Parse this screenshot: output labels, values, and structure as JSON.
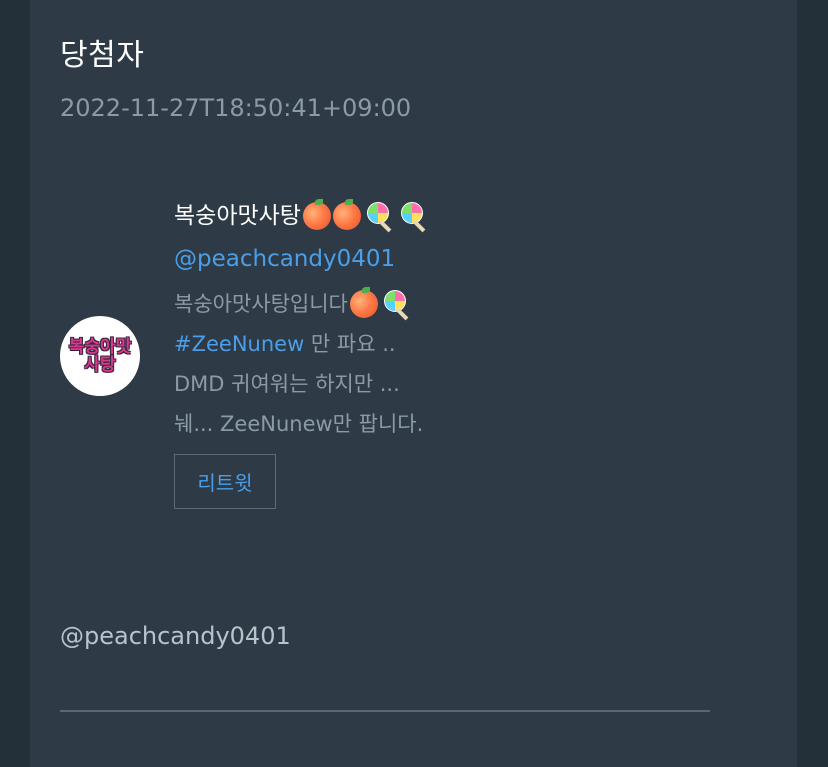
{
  "header": {
    "title": "당첨자",
    "timestamp": "2022-11-27T18:50:41+09:00"
  },
  "user": {
    "display_name": "복숭아맛사탕",
    "name_emojis": [
      "peach-icon",
      "peach-icon",
      "lollipop-icon",
      "lollipop-icon"
    ],
    "handle": "@peachcandy0401",
    "avatar_text_line1": "복숭아맛",
    "avatar_text_line2": "사탕",
    "bio": {
      "line1_text": "복숭아맛사탕입니다",
      "line1_emojis": [
        "peach-icon",
        "lollipop-icon"
      ],
      "line2_hashtag": "#ZeeNunew",
      "line2_rest": " 만 파요 ..",
      "line3": "DMD 귀여워는 하지만 ...",
      "line4": "눼... ZeeNunew만 팝니다."
    }
  },
  "actions": {
    "retweet_label": "리트윗"
  },
  "footer": {
    "handle": "@peachcandy0401"
  },
  "colors": {
    "background": "#243039",
    "panel": "#2e3a45",
    "link": "#4a9fe8",
    "muted_text": "#8c9aa8"
  }
}
